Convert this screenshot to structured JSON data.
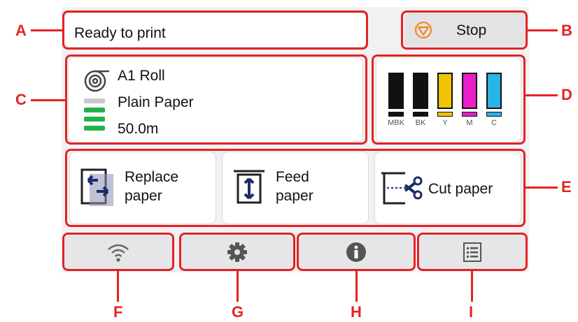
{
  "status": {
    "text": "Ready to print"
  },
  "stop_button": {
    "label": "Stop"
  },
  "paper": {
    "size": "A1 Roll",
    "type": "Plain Paper",
    "remaining": "50.0m",
    "remaining_level": 0.75
  },
  "ink": [
    {
      "name": "MBK",
      "color": "#111111",
      "level": 1.0
    },
    {
      "name": "BK",
      "color": "#111111",
      "level": 1.0
    },
    {
      "name": "Y",
      "color": "#f0c400",
      "level": 1.0
    },
    {
      "name": "M",
      "color": "#e81ec8",
      "level": 1.0
    },
    {
      "name": "C",
      "color": "#2ab4e8",
      "level": 1.0
    }
  ],
  "actions": {
    "replace_line1": "Replace",
    "replace_line2": "paper",
    "feed_line1": "Feed",
    "feed_line2": "paper",
    "cut": "Cut paper"
  },
  "bottom_icons": [
    "wifi-icon",
    "gear-icon",
    "info-icon",
    "menu-list-icon"
  ],
  "callouts": {
    "a": "A",
    "b": "B",
    "c": "C",
    "d": "D",
    "e": "E",
    "f": "F",
    "g": "G",
    "h": "H",
    "i": "I"
  },
  "colors": {
    "callout_red": "#e52222",
    "accent_orange": "#f08a24",
    "green_level": "#22b24c"
  }
}
